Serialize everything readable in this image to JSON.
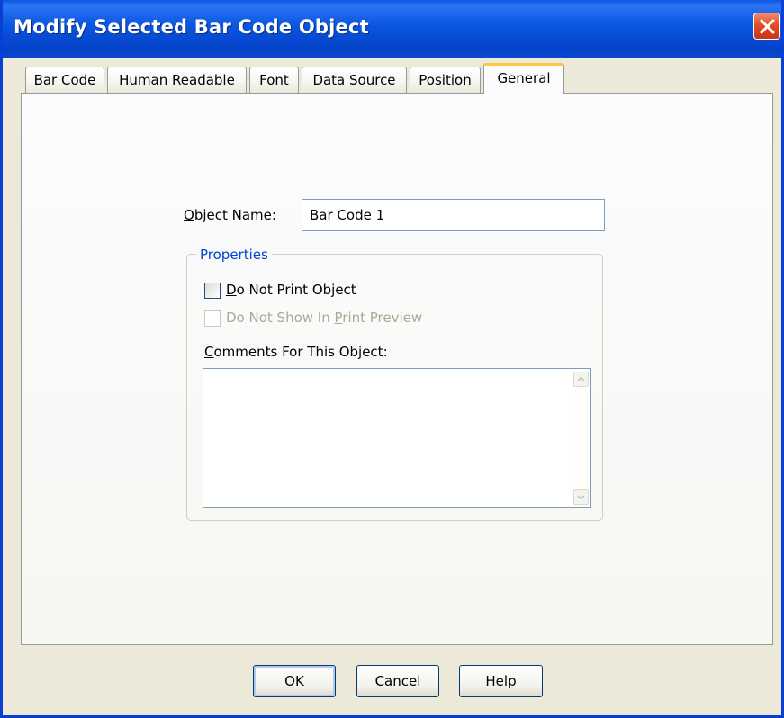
{
  "window": {
    "title": "Modify Selected Bar Code Object"
  },
  "tabs": [
    {
      "label": "Bar Code"
    },
    {
      "label": "Human Readable"
    },
    {
      "label": "Font"
    },
    {
      "label": "Data Source"
    },
    {
      "label": "Position"
    },
    {
      "label": "General",
      "active": true
    }
  ],
  "general": {
    "object_name_label": "Object Name:",
    "object_name_value": "Bar Code 1",
    "properties_title": "Properties",
    "do_not_print_label": "Do Not Print Object",
    "do_not_show_preview_label": "Do Not Show In Print Preview",
    "comments_label": "Comments For This Object:",
    "comments_value": ""
  },
  "buttons": {
    "ok": "OK",
    "cancel": "Cancel",
    "help": "Help"
  },
  "colors": {
    "title_bar": "#0a55e0",
    "active_tab_highlight": "#ffc73d",
    "group_title": "#0046d5"
  }
}
